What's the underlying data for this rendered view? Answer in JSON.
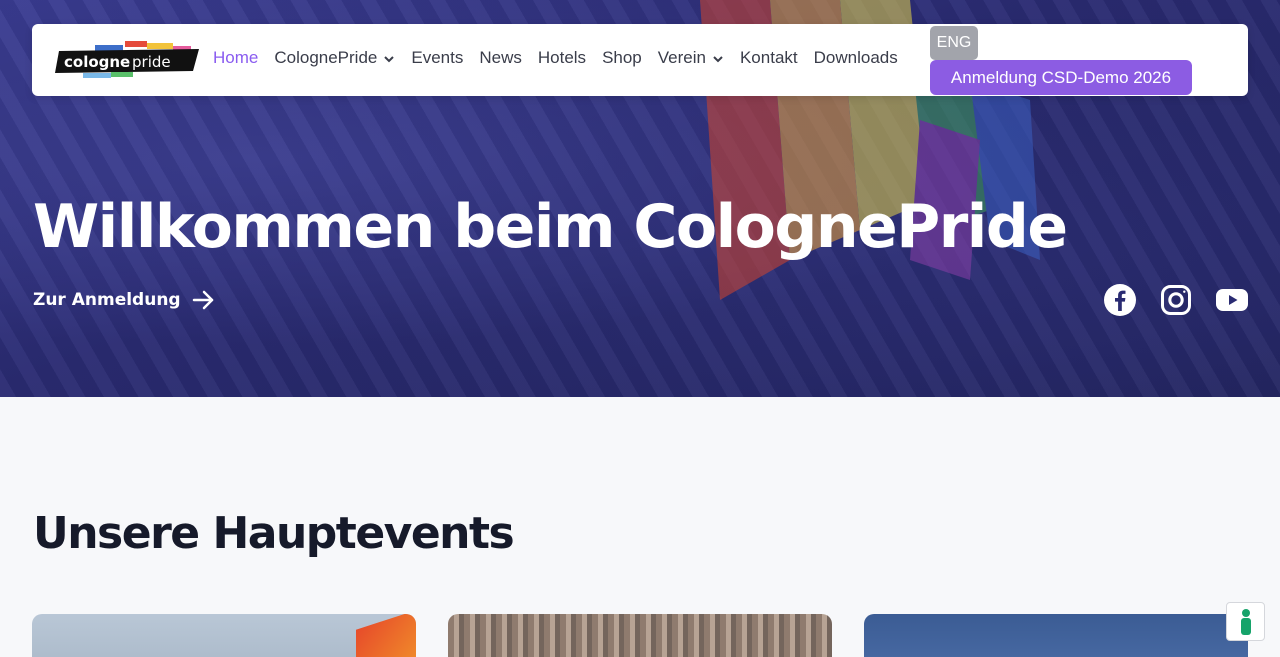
{
  "header": {
    "logo_text": "cologne pride",
    "nav": [
      {
        "label": "Home",
        "active": true,
        "dropdown": false
      },
      {
        "label": "CologneP ride",
        "active": false,
        "dropdown": true
      },
      {
        "label": "Events",
        "active": false,
        "dropdown": false
      },
      {
        "label": "News",
        "active": false,
        "dropdown": false
      },
      {
        "label": "Hotels",
        "active": false,
        "dropdown": false
      },
      {
        "label": "Shop",
        "active": false,
        "dropdown": false
      },
      {
        "label": "Verein",
        "active": false,
        "dropdown": true
      },
      {
        "label": "Kontakt",
        "active": false,
        "dropdown": false
      },
      {
        "label": "Downloads",
        "active": false,
        "dropdown": false
      }
    ],
    "lang_button": "ENG",
    "cta_button": "Anmeldung CSD-Demo 2026"
  },
  "hero": {
    "title": "Willkommen beim ColognePride",
    "link_label": "Zur Anmeldung",
    "socials": [
      "facebook-icon",
      "instagram-icon",
      "youtube-icon"
    ]
  },
  "main": {
    "section_title": "Unsere Hauptevents"
  },
  "colors": {
    "accent": "#8c5ce3",
    "nav_active": "#8a5cf0",
    "hero_overlay": "#2a2b72",
    "heading": "#161a2a"
  }
}
